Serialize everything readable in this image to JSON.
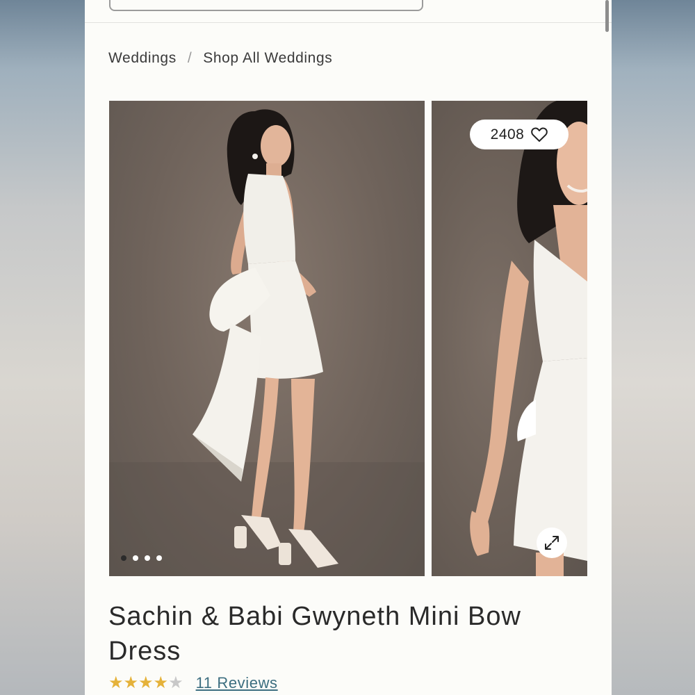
{
  "breadcrumb": {
    "items": [
      "Weddings",
      "Shop All Weddings"
    ],
    "separator": "/"
  },
  "gallery": {
    "main_image_alt": "Model wearing white mini dress with large bow, back view",
    "second_image_alt": "Model wearing white mini dress, front view",
    "carousel_dots": 4,
    "active_dot": 1
  },
  "likes": {
    "count": "2408"
  },
  "product": {
    "title": "Sachin & Babi Gwyneth Mini Bow Dress",
    "rating": 4,
    "rating_max": 5,
    "reviews_label": "11 Reviews"
  },
  "colors": {
    "page_bg": "#fcfcf9",
    "text": "#2a2a2a",
    "star": "#e5b23a",
    "link": "#3c6e80"
  }
}
